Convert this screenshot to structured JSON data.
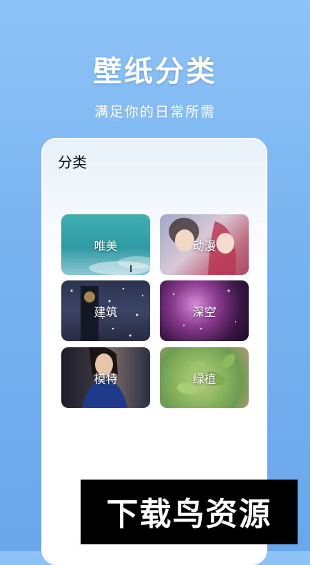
{
  "header": {
    "title": "壁纸分类",
    "subtitle": "满足你的日常所需"
  },
  "card": {
    "title": "分类",
    "categories": [
      {
        "label": "唯美",
        "theme": "teal-sky"
      },
      {
        "label": "动漫",
        "theme": "anime-pink"
      },
      {
        "label": "建筑",
        "theme": "clock-tower-night"
      },
      {
        "label": "深空",
        "theme": "purple-galaxy"
      },
      {
        "label": "模特",
        "theme": "model-portrait"
      },
      {
        "label": "绿植",
        "theme": "succulent-green"
      }
    ]
  },
  "watermark": {
    "text": "下载鸟资源"
  },
  "colors": {
    "background_top": "#8ec3f6",
    "background_bottom": "#6aa7eb",
    "card": "#ffffff",
    "watermark_bg": "#000000"
  }
}
